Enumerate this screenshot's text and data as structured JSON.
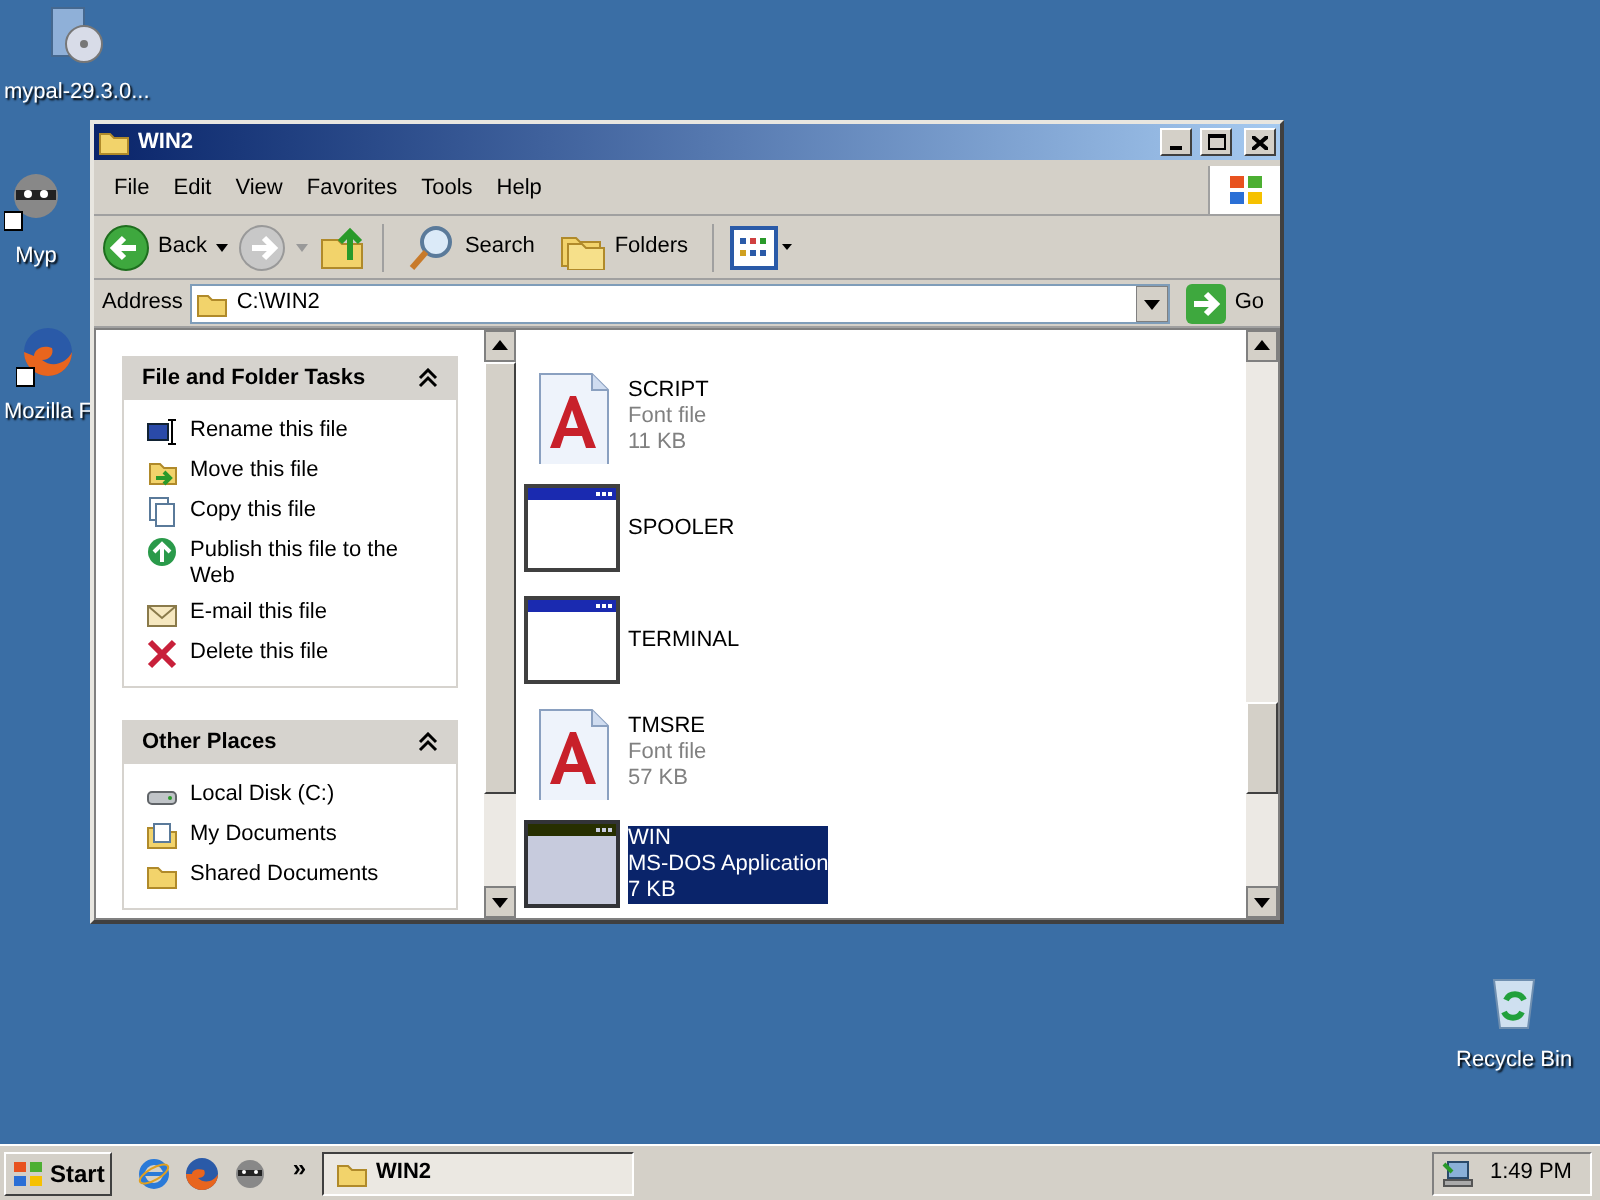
{
  "desktop_icons": [
    {
      "kind": "installer",
      "label": "mypal-29.3.0..."
    },
    {
      "kind": "raccoon",
      "label": "Myp"
    },
    {
      "kind": "firefox",
      "label": "Mozilla F"
    },
    {
      "kind": "recycle",
      "label": "Recycle Bin"
    }
  ],
  "window": {
    "title": "WIN2"
  },
  "menu": [
    "File",
    "Edit",
    "View",
    "Favorites",
    "Tools",
    "Help"
  ],
  "toolbar": {
    "back": "Back",
    "search": "Search",
    "folders": "Folders"
  },
  "address": {
    "label": "Address",
    "value": "C:\\WIN2",
    "go": "Go"
  },
  "task_panels": [
    {
      "title": "File and Folder Tasks",
      "items": [
        {
          "kind": "rename",
          "label": "Rename this file"
        },
        {
          "kind": "move",
          "label": "Move this file"
        },
        {
          "kind": "copy",
          "label": "Copy this file"
        },
        {
          "kind": "publish",
          "label": "Publish this file to the Web"
        },
        {
          "kind": "email",
          "label": "E-mail this file"
        },
        {
          "kind": "delete",
          "label": "Delete this file"
        }
      ]
    },
    {
      "title": "Other Places",
      "items": [
        {
          "kind": "disk",
          "label": "Local Disk (C:)"
        },
        {
          "kind": "documents",
          "label": "My Documents"
        },
        {
          "kind": "folder",
          "label": "Shared Documents"
        }
      ]
    }
  ],
  "files": [
    {
      "kind": "font",
      "name": "SCRIPT",
      "type": "Font file",
      "size": "11 KB",
      "selected": false
    },
    {
      "kind": "app",
      "name": "SPOOLER",
      "selected": false
    },
    {
      "kind": "app",
      "name": "TERMINAL",
      "selected": false
    },
    {
      "kind": "font",
      "name": "TMSRE",
      "type": "Font file",
      "size": "57 KB",
      "selected": false
    },
    {
      "kind": "app",
      "name": "WIN",
      "type": "MS-DOS Application",
      "size": "7 KB",
      "selected": true
    }
  ],
  "taskbar": {
    "start": "Start",
    "quick_launch": [
      {
        "kind": "ie"
      },
      {
        "kind": "firefox"
      },
      {
        "kind": "raccoon"
      }
    ],
    "overflow": "»",
    "task": "WIN2",
    "clock": "1:49 PM"
  }
}
